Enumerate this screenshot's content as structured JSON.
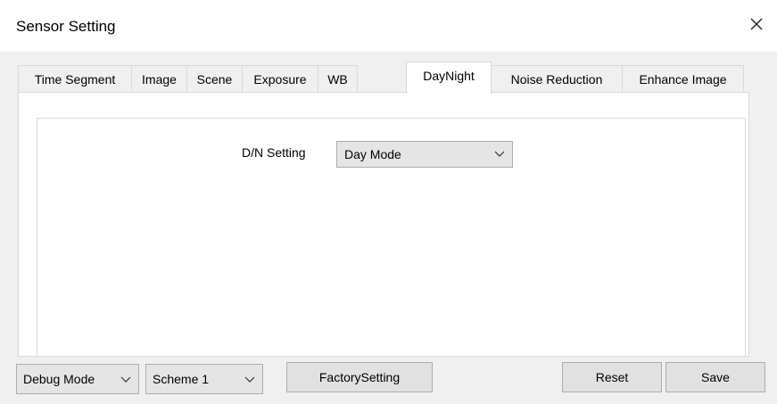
{
  "window": {
    "title": "Sensor Setting"
  },
  "tabs": [
    {
      "label": "Time Segment"
    },
    {
      "label": "Image"
    },
    {
      "label": "Scene"
    },
    {
      "label": "Exposure"
    },
    {
      "label": "WB"
    },
    {
      "label": "DayNight",
      "active": true
    },
    {
      "label": "Noise Reduction"
    },
    {
      "label": "Enhance Image"
    }
  ],
  "daynight": {
    "dn_setting_label": "D/N Setting",
    "dn_setting_value": "Day Mode"
  },
  "footer": {
    "debug_mode_value": "Debug Mode",
    "scheme_value": "Scheme 1",
    "factory_setting_label": "FactorySetting",
    "reset_label": "Reset",
    "save_label": "Save"
  },
  "colors": {
    "window_bg": "#f0f0f0",
    "panel_bg": "#ffffff",
    "control_bg": "#e5e5e5",
    "button_bg": "#e1e1e1",
    "border": "#adadad"
  },
  "icons": {
    "close": "close-icon",
    "dropdown": "chevron-down-icon"
  }
}
